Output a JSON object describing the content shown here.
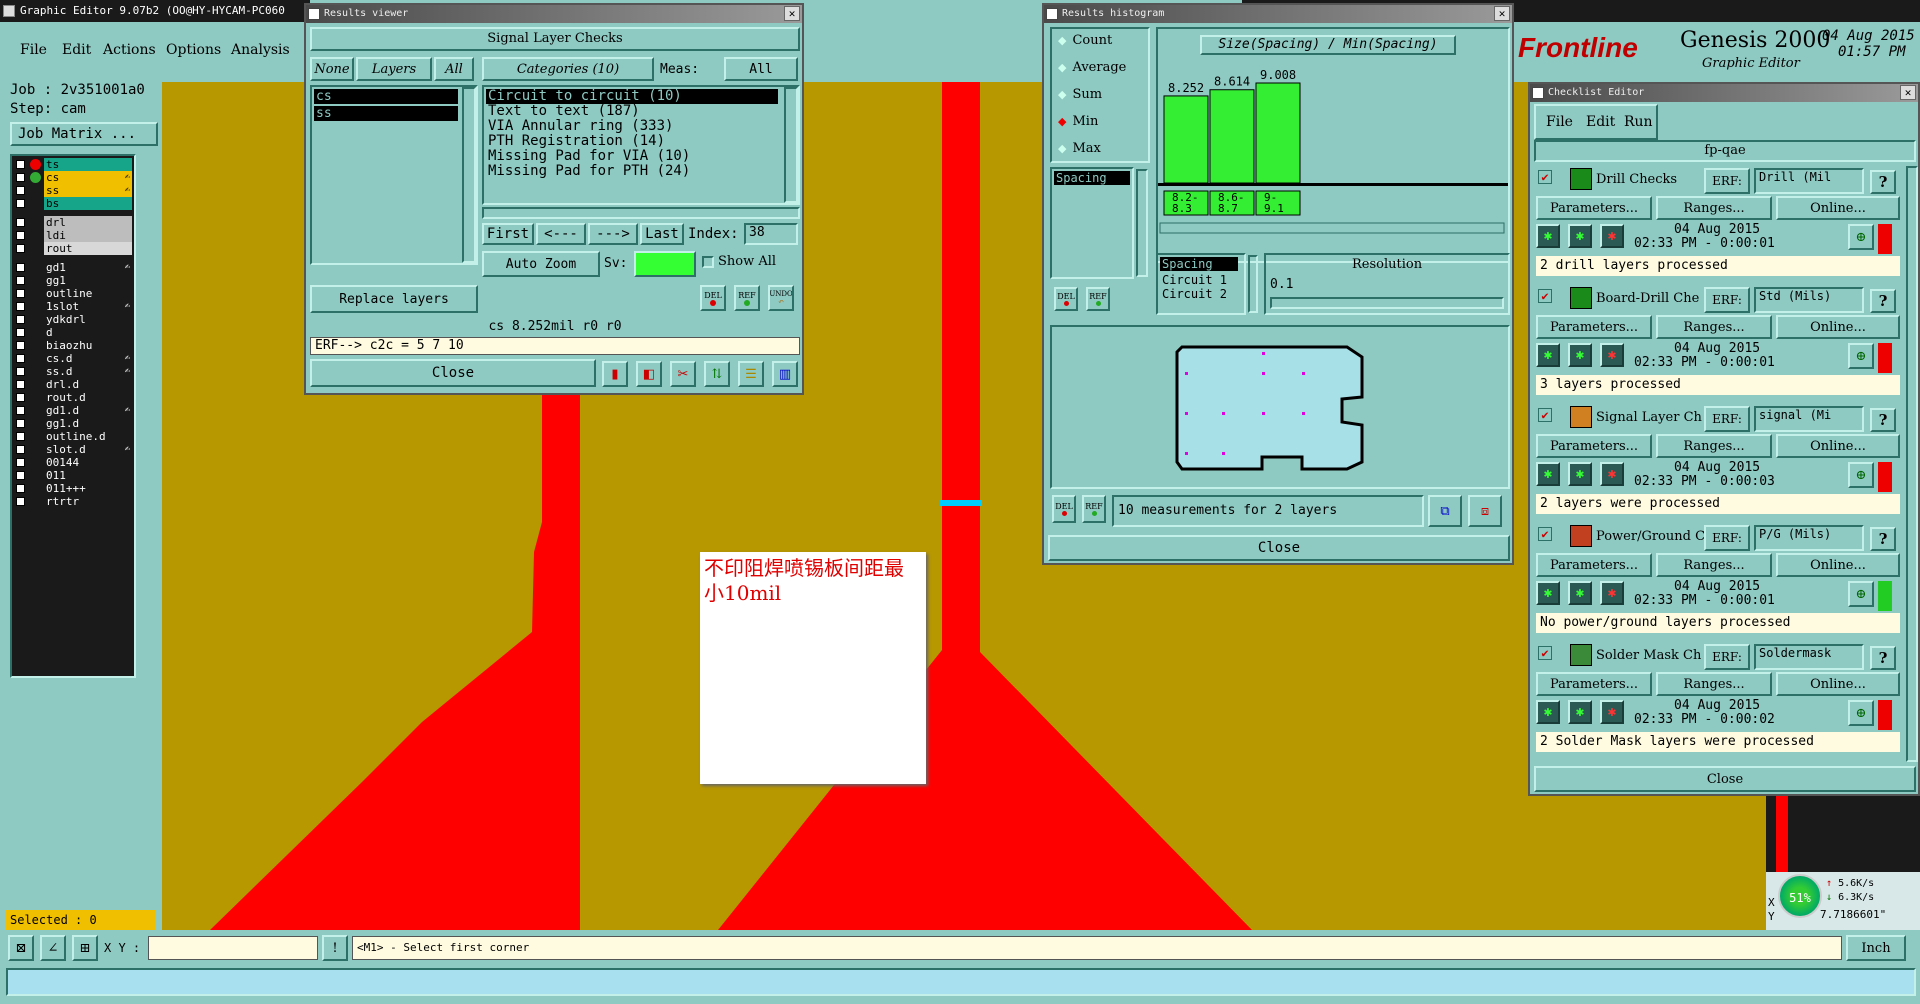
{
  "main": {
    "title": "Graphic Editor 9.07b2 (OO@HY-HYCAM-PC060",
    "menu": [
      "File",
      "Edit",
      "Actions",
      "Options",
      "Analysis"
    ],
    "job_label": "Job : 2v351001a0",
    "step_label": "Step: cam",
    "job_matrix": "Job Matrix ...",
    "layers_top": [
      "ts",
      "cs",
      "ss",
      "bs"
    ],
    "layers_mid": [
      "drl",
      "ldi",
      "rout"
    ],
    "layers_low": [
      "gd1",
      "gg1",
      "outline",
      "1slot",
      "ydkdrl",
      "d",
      "biaozhu",
      "cs.d",
      "ss.d",
      "drl.d",
      "rout.d",
      "gd1.d",
      "gg1.d",
      "outline.d",
      "slot.d",
      "00144",
      "011",
      "011+++",
      "rtrtr"
    ],
    "selected": "Selected : 0",
    "xy_label": "X Y :",
    "prompt": "<M1> - Select first corner",
    "units": "Inch",
    "annotation": "不印阻焊喷锡板间距最小10mil",
    "colors": {
      "canvas": "#b89800",
      "copper": "#ff0000",
      "marker": "#00ccff"
    }
  },
  "brand": {
    "logo": "Frontline",
    "product": "Genesis 2000",
    "subtitle": "Graphic Editor",
    "date": "04 Aug 2015",
    "time": "01:57 PM"
  },
  "results_viewer": {
    "title": "Results viewer",
    "heading": "Signal Layer Checks",
    "none_btn": "None",
    "layers_btn": "Layers",
    "all_btn": "All",
    "categories_btn": "Categories (10)",
    "meas_label": "Meas:",
    "meas_value": "All",
    "layers": [
      "cs",
      "ss"
    ],
    "categories": [
      "Circuit to circuit (10)",
      "Text to text (187)",
      "VIA Annular ring (333)",
      "PTH Registration (14)",
      "Missing Pad for VIA (10)",
      "Missing Pad for PTH (24)"
    ],
    "nav": [
      "First",
      "<---",
      "--->",
      "Last"
    ],
    "index_label": "Index:",
    "index_value": "38",
    "auto_zoom": "Auto Zoom",
    "sv_label": "Sv:",
    "show_all": "Show All",
    "replace_layers": "Replace layers",
    "tool_del": "DEL",
    "tool_ref": "REF",
    "tool_undo": "UNDO",
    "status": "cs 8.252mil   r0   r0",
    "erf": "ERF--> c2c = 5 7 10",
    "close": "Close"
  },
  "histogram": {
    "title": "Results histogram",
    "options": [
      "Count",
      "Average",
      "Sum",
      "Min",
      "Max"
    ],
    "selected_option": "Min",
    "list_items": [
      "Spacing"
    ],
    "header": "Size(Spacing) / Min(Spacing)",
    "bar_values": [
      "8.252",
      "8.614",
      "9.008"
    ],
    "bar_ranges": [
      "8.2-\n8.3",
      "8.6-\n8.7",
      "9-\n9.1"
    ],
    "meas_list": [
      "Spacing",
      "Circuit 1",
      "Circuit 2"
    ],
    "resolution_label": "Resolution",
    "resolution_value": "0.1",
    "summary": "10 measurements for 2 layers",
    "close": "Close",
    "chart_data": {
      "type": "bar",
      "categories": [
        "8.2-8.3",
        "8.6-8.7",
        "9-9.1"
      ],
      "values": [
        8.252,
        8.614,
        9.008
      ],
      "title": "Size(Spacing) / Min(Spacing)"
    }
  },
  "checklist": {
    "title": "Checklist Editor",
    "menu": [
      "File",
      "Edit",
      "Run"
    ],
    "name": "fp-qae",
    "rows": [
      {
        "label": "Drill Checks",
        "erf": "Drill (Mil",
        "date": "04 Aug 2015",
        "time": "02:33 PM - 0:00:01",
        "status": "2 drill layers processed",
        "flag": "red"
      },
      {
        "label": "Board-Drill Che",
        "erf": "Std (Mils)",
        "date": "04 Aug 2015",
        "time": "02:33 PM - 0:00:01",
        "status": "3 layers processed",
        "flag": "red"
      },
      {
        "label": "Signal Layer Ch",
        "erf": "signal (Mi",
        "date": "04 Aug 2015",
        "time": "02:33 PM - 0:00:03",
        "status": "2 layers were processed",
        "flag": "red"
      },
      {
        "label": "Power/Ground C",
        "erf": "P/G (Mils)",
        "date": "04 Aug 2015",
        "time": "02:33 PM - 0:00:01",
        "status": "No power/ground layers processed",
        "flag": "green"
      },
      {
        "label": "Solder Mask Ch",
        "erf": "Soldermask",
        "date": "04 Aug 2015",
        "time": "02:33 PM - 0:00:02",
        "status": "2 Solder Mask layers were processed",
        "flag": "red"
      }
    ],
    "erf_label": "ERF:",
    "parameters": "Parameters...",
    "ranges": "Ranges...",
    "online": "Online...",
    "help": "?",
    "close": "Close"
  },
  "netmon": {
    "percent": "51%",
    "up": "5.6K/s",
    "down": "6.3K/s",
    "x": "X",
    "y": "Y",
    "coord": "7.7186601\""
  }
}
